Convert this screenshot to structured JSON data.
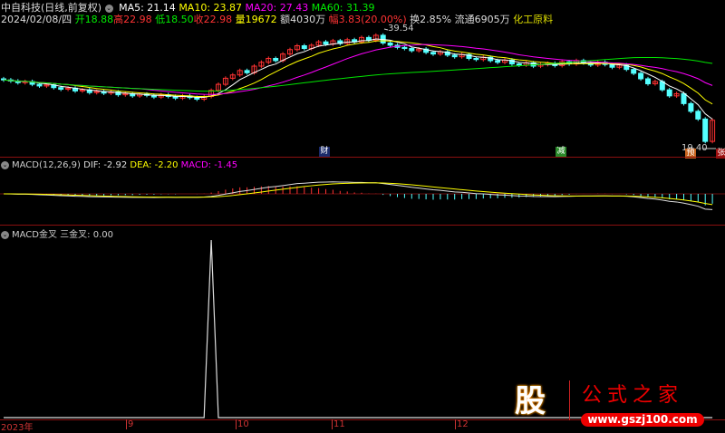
{
  "header": {
    "stock": "中自科技(日线,前复权)",
    "ma5": "MA5: 21.14",
    "ma10": "MA10: 23.87",
    "ma20": "MA20: 27.43",
    "ma60": "MA60: 31.39"
  },
  "quote": {
    "date": "2024/02/08/四",
    "open": "开18.88",
    "high": "高22.98",
    "low": "低18.50",
    "close": "收22.98",
    "volume": "量19672",
    "amount": "额4030万",
    "change": "幅3.83(20.00%)",
    "turnover": "换2.85%",
    "float": "流通6905万",
    "sector": "化工原料"
  },
  "price_panel": {
    "high_label": "39.54",
    "low_label": "19.40",
    "badges": [
      "财",
      "减",
      "预",
      "张"
    ]
  },
  "macd": {
    "title": "MACD(12,26,9)",
    "dif": "DIF: -2.92",
    "dea": "DEA: -2.20",
    "macd": "MACD: -1.45"
  },
  "cross": {
    "title": "MACD金叉",
    "value": "三金叉: 0.00"
  },
  "axis": {
    "labels": [
      "2023年",
      "9",
      "10",
      "11",
      "12"
    ]
  },
  "logo": {
    "text": "股",
    "name": "公式之家",
    "url": "www.gszj100.com"
  },
  "colors": {
    "up": "#ff3232",
    "down": "#54ffff",
    "ma5": "#ffffff",
    "ma10": "#ffff00",
    "ma20": "#ff00ff",
    "ma60": "#00e600"
  },
  "chart_data": {
    "type": "candlestick",
    "close": [
      30.3,
      30.1,
      29.8,
      30.0,
      29.5,
      29.2,
      29.4,
      28.9,
      28.6,
      28.8,
      28.3,
      28.5,
      28.0,
      28.2,
      27.9,
      28.1,
      27.6,
      27.8,
      27.4,
      27.7,
      27.5,
      27.2,
      27.6,
      27.3,
      27.0,
      27.4,
      27.1,
      26.8,
      27.3,
      28.4,
      29.5,
      30.6,
      31.2,
      32.0,
      31.6,
      32.8,
      33.5,
      34.2,
      33.8,
      35.0,
      35.8,
      36.5,
      36.0,
      36.6,
      37.2,
      36.8,
      37.4,
      36.9,
      37.6,
      37.2,
      38.0,
      37.5,
      38.4,
      37.0,
      36.6,
      36.2,
      36.0,
      35.6,
      35.9,
      35.3,
      35.0,
      35.4,
      34.8,
      34.5,
      34.9,
      34.2,
      34.0,
      34.4,
      33.8,
      33.5,
      33.9,
      33.2,
      33.0,
      33.4,
      32.8,
      33.1,
      33.3,
      32.9,
      33.6,
      33.2,
      33.8,
      33.4,
      33.0,
      33.5,
      33.1,
      32.6,
      33.0,
      32.2,
      31.5,
      30.5,
      29.6,
      30.0,
      28.5,
      27.4,
      27.8,
      26.0,
      24.6,
      23.2,
      19.14,
      22.98
    ],
    "price_range": [
      18.5,
      39.54
    ],
    "cross_signal_nonzero": {
      "29": 1
    }
  }
}
